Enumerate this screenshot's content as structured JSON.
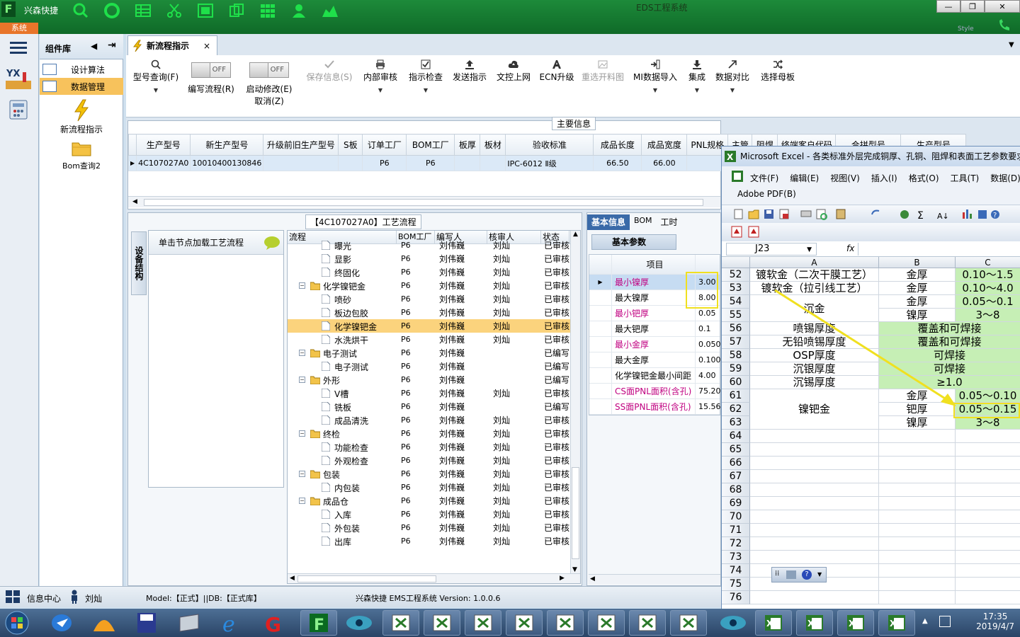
{
  "app": {
    "brand": "兴森快捷",
    "window_title": "EDS工程系统",
    "system_tab": "系统",
    "style_label": "Style"
  },
  "left_nav": {
    "header": "组件库",
    "items": [
      {
        "label": "设计算法",
        "selected": false
      },
      {
        "label": "数据管理",
        "selected": true
      }
    ],
    "launchers": [
      {
        "label": "新流程指示",
        "icon": "lightning-icon"
      },
      {
        "label": "Bom查询2",
        "icon": "folder-icon"
      }
    ]
  },
  "doc_tab": {
    "label": "新流程指示"
  },
  "ribbon": {
    "buttons": [
      {
        "label": "型号查询(F)",
        "icon": "search-icon",
        "enabled": true
      },
      {
        "label": "编写流程(R)",
        "icon": "toggle-off",
        "toggle_text": "OFF",
        "enabled": true
      },
      {
        "label": "启动修改(E)",
        "label2": "取消(Z)",
        "icon": "toggle-off",
        "toggle_text": "OFF",
        "enabled": true
      },
      {
        "label": "保存信息(S)",
        "icon": "check-icon",
        "enabled": false
      },
      {
        "label": "内部审核",
        "icon": "printer-icon",
        "enabled": true
      },
      {
        "label": "指示检查",
        "icon": "check-box-icon",
        "enabled": true
      },
      {
        "label": "发送指示",
        "icon": "upload-icon",
        "enabled": true
      },
      {
        "label": "文控上网",
        "icon": "cloud-upload-icon",
        "enabled": true
      },
      {
        "label": "ECN升级",
        "icon": "letter-a-icon",
        "enabled": true
      },
      {
        "label": "重选开料图",
        "icon": "image-icon",
        "enabled": false
      },
      {
        "label": "MI数据导入",
        "icon": "import-icon",
        "enabled": true
      },
      {
        "label": "集成",
        "icon": "download-icon",
        "enabled": true
      },
      {
        "label": "数据对比",
        "icon": "compare-icon",
        "enabled": true
      },
      {
        "label": "选择母板",
        "icon": "shuffle-icon",
        "enabled": true
      }
    ]
  },
  "main_info": {
    "title": "主要信息",
    "columns": [
      "生产型号",
      "新生产型号",
      "升级前旧生产型号",
      "S板",
      "订单工厂",
      "BOM工厂",
      "板厚",
      "板材",
      "验收标准",
      "成品长度",
      "成品宽度",
      "PNL规格",
      "主管",
      "阻焊",
      "终端客户代码",
      "合拼型号",
      "生产型号"
    ],
    "row": [
      "4C107027A0",
      "10010400130846",
      "",
      "",
      "P6",
      "P6",
      "",
      "",
      "IPC-6012 Ⅱ级",
      "66.50",
      "66.00",
      "",
      "",
      "",
      "",
      "",
      ""
    ]
  },
  "process": {
    "title": "【4C107027A0】工艺流程",
    "side_tab": "设备结构",
    "node_header": "单击节点加载工艺流程",
    "columns": [
      "流程",
      "BOM工厂",
      "编写人",
      "核审人",
      "状态"
    ],
    "rows": [
      {
        "name": "曝光",
        "level": 2,
        "type": "doc",
        "bom": "P6",
        "writer": "刘伟巍",
        "reviewer": "刘灿",
        "status": "已审核"
      },
      {
        "name": "显影",
        "level": 2,
        "type": "doc",
        "bom": "P6",
        "writer": "刘伟巍",
        "reviewer": "刘灿",
        "status": "已审核"
      },
      {
        "name": "终固化",
        "level": 2,
        "type": "doc",
        "bom": "P6",
        "writer": "刘伟巍",
        "reviewer": "刘灿",
        "status": "已审核"
      },
      {
        "name": "化学镍钯金",
        "level": 1,
        "type": "folder",
        "bom": "P6",
        "writer": "刘伟巍",
        "reviewer": "刘灿",
        "status": "已审核"
      },
      {
        "name": "喷砂",
        "level": 2,
        "type": "doc",
        "bom": "P6",
        "writer": "刘伟巍",
        "reviewer": "刘灿",
        "status": "已审核"
      },
      {
        "name": "板边包胶",
        "level": 2,
        "type": "doc",
        "bom": "P6",
        "writer": "刘伟巍",
        "reviewer": "刘灿",
        "status": "已审核"
      },
      {
        "name": "化学镍钯金",
        "level": 2,
        "type": "doc",
        "bom": "P6",
        "writer": "刘伟巍",
        "reviewer": "刘灿",
        "status": "已审核",
        "selected": true
      },
      {
        "name": "水洗烘干",
        "level": 2,
        "type": "doc",
        "bom": "P6",
        "writer": "刘伟巍",
        "reviewer": "刘灿",
        "status": "已审核"
      },
      {
        "name": "电子测试",
        "level": 1,
        "type": "folder",
        "bom": "P6",
        "writer": "刘伟巍",
        "reviewer": "",
        "status": "已编写"
      },
      {
        "name": "电子测试",
        "level": 2,
        "type": "doc",
        "bom": "P6",
        "writer": "刘伟巍",
        "reviewer": "",
        "status": "已编写"
      },
      {
        "name": "外形",
        "level": 1,
        "type": "folder",
        "bom": "P6",
        "writer": "刘伟巍",
        "reviewer": "",
        "status": "已编写"
      },
      {
        "name": "V槽",
        "level": 2,
        "type": "doc",
        "bom": "P6",
        "writer": "刘伟巍",
        "reviewer": "刘灿",
        "status": "已审核"
      },
      {
        "name": "铣板",
        "level": 2,
        "type": "doc",
        "bom": "P6",
        "writer": "刘伟巍",
        "reviewer": "",
        "status": "已编写"
      },
      {
        "name": "成品清洗",
        "level": 2,
        "type": "doc",
        "bom": "P6",
        "writer": "刘伟巍",
        "reviewer": "刘灿",
        "status": "已审核"
      },
      {
        "name": "终检",
        "level": 1,
        "type": "folder",
        "bom": "P6",
        "writer": "刘伟巍",
        "reviewer": "刘灿",
        "status": "已审核"
      },
      {
        "name": "功能检查",
        "level": 2,
        "type": "doc",
        "bom": "P6",
        "writer": "刘伟巍",
        "reviewer": "刘灿",
        "status": "已审核"
      },
      {
        "name": "外观检查",
        "level": 2,
        "type": "doc",
        "bom": "P6",
        "writer": "刘伟巍",
        "reviewer": "刘灿",
        "status": "已审核"
      },
      {
        "name": "包装",
        "level": 1,
        "type": "folder",
        "bom": "P6",
        "writer": "刘伟巍",
        "reviewer": "刘灿",
        "status": "已审核"
      },
      {
        "name": "内包装",
        "level": 2,
        "type": "doc",
        "bom": "P6",
        "writer": "刘伟巍",
        "reviewer": "刘灿",
        "status": "已审核"
      },
      {
        "name": "成品仓",
        "level": 1,
        "type": "folder",
        "bom": "P6",
        "writer": "刘伟巍",
        "reviewer": "刘灿",
        "status": "已审核"
      },
      {
        "name": "入库",
        "level": 2,
        "type": "doc",
        "bom": "P6",
        "writer": "刘伟巍",
        "reviewer": "刘灿",
        "status": "已审核"
      },
      {
        "name": "外包装",
        "level": 2,
        "type": "doc",
        "bom": "P6",
        "writer": "刘伟巍",
        "reviewer": "刘灿",
        "status": "已审核"
      },
      {
        "name": "出库",
        "level": 2,
        "type": "doc",
        "bom": "P6",
        "writer": "刘伟巍",
        "reviewer": "刘灿",
        "status": "已审核"
      }
    ]
  },
  "basic_info": {
    "tabs": [
      "基本信息",
      "BOM",
      "工时"
    ],
    "sub_tab": "基本参数",
    "column": "项目",
    "rows": [
      {
        "label": "最小镍厚",
        "value": "3.00",
        "highlight": true,
        "red": true
      },
      {
        "label": "最大镍厚",
        "value": "8.00",
        "highlight": true,
        "red": false
      },
      {
        "label": "最小钯厚",
        "value": "0.05",
        "red": true
      },
      {
        "label": "最大钯厚",
        "value": "0.1",
        "red": false
      },
      {
        "label": "最小金厚",
        "value": "0.050",
        "red": true
      },
      {
        "label": "最大金厚",
        "value": "0.100",
        "red": false
      },
      {
        "label": "化学镍钯金最小间距",
        "value": "4.00",
        "red": false
      },
      {
        "label": "CS面PNL面积(含孔)",
        "value": "75.20",
        "red": true
      },
      {
        "label": "SS面PNL面积(含孔)",
        "value": "15.56",
        "red": true
      }
    ]
  },
  "status_bar": {
    "info_center": "信息中心",
    "user": "刘灿",
    "model_text": "Model:【正式】||DB:【正式库】",
    "version_text": "兴森快捷 EMS工程系统 Version: 1.0.0.6"
  },
  "excel": {
    "title": "Microsoft Excel - 各类标准外层完成铜厚、孔铜、阻焊和表面工艺参数要求",
    "menu": [
      "文件(F)",
      "编辑(E)",
      "视图(V)",
      "插入(I)",
      "格式(O)",
      "工具(T)",
      "数据(D)"
    ],
    "menu2": "Adobe PDF(B)",
    "name_box": "J23",
    "fx": "fx",
    "col_headers": [
      "A",
      "B",
      "C"
    ],
    "rows": [
      {
        "n": "52",
        "a": "镀软金（二次干膜工艺）",
        "b": "金厚",
        "c": "0.10～1.5"
      },
      {
        "n": "53",
        "a": "镀软金（拉引线工艺）",
        "b": "金厚",
        "c": "0.10～4.0"
      },
      {
        "n": "54",
        "a": "沉金",
        "b": "金厚",
        "c": "0.05～0.1"
      },
      {
        "n": "55",
        "a": "",
        "b": "镍厚",
        "c": "3～8"
      },
      {
        "n": "56",
        "a": "喷锡厚度",
        "b": "覆盖和可焊接",
        "c": ""
      },
      {
        "n": "57",
        "a": "无铅喷锡厚度",
        "b": "覆盖和可焊接",
        "c": ""
      },
      {
        "n": "58",
        "a": "OSP厚度",
        "b": "可焊接",
        "c": ""
      },
      {
        "n": "59",
        "a": "沉银厚度",
        "b": "可焊接",
        "c": ""
      },
      {
        "n": "60",
        "a": "沉锡厚度",
        "b": "≥1.0",
        "c": ""
      },
      {
        "n": "61",
        "a": "镍钯金",
        "b": "金厚",
        "c": "0.05～0.10"
      },
      {
        "n": "62",
        "a": "",
        "b": "钯厚",
        "c": "0.05～0.15"
      },
      {
        "n": "63",
        "a": "",
        "b": "镍厚",
        "c": "3～8"
      },
      {
        "n": "64",
        "a": "",
        "b": "",
        "c": ""
      },
      {
        "n": "65",
        "a": "",
        "b": "",
        "c": ""
      },
      {
        "n": "66",
        "a": "",
        "b": "",
        "c": ""
      },
      {
        "n": "67",
        "a": "",
        "b": "",
        "c": ""
      },
      {
        "n": "68",
        "a": "",
        "b": "",
        "c": ""
      },
      {
        "n": "69",
        "a": "",
        "b": "",
        "c": ""
      },
      {
        "n": "70",
        "a": "",
        "b": "",
        "c": ""
      },
      {
        "n": "71",
        "a": "",
        "b": "",
        "c": ""
      },
      {
        "n": "72",
        "a": "",
        "b": "",
        "c": ""
      },
      {
        "n": "73",
        "a": "",
        "b": "",
        "c": ""
      },
      {
        "n": "74",
        "a": "",
        "b": "",
        "c": ""
      },
      {
        "n": "75",
        "a": "",
        "b": "",
        "c": ""
      },
      {
        "n": "76",
        "a": "",
        "b": "",
        "c": ""
      }
    ]
  },
  "taskbar": {
    "time": "17:35",
    "date": "2019/4/7"
  },
  "colors": {
    "title_green": "#1d8a3a",
    "selection": "#f7c25c",
    "excel_green": "#c6efb5",
    "annotation_yellow": "#f0e020",
    "label_red": "#c00080"
  }
}
